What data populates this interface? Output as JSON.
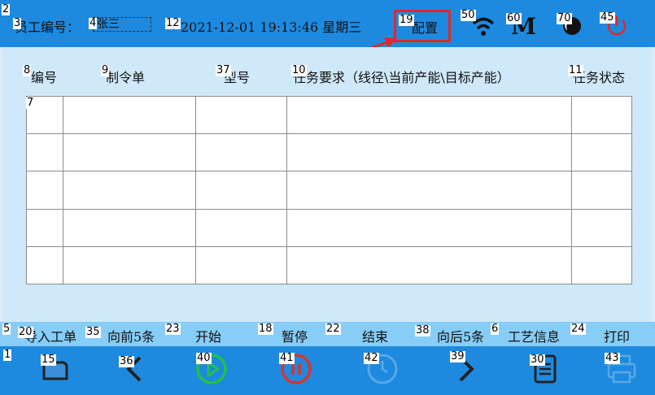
{
  "header": {
    "employee_label": "员工编号：",
    "employee_value": "张三",
    "datetime": "2021-12-01 19:13:46 星期三",
    "config_label": "配置"
  },
  "columns": [
    "编号",
    "制令单",
    "型号",
    "任务要求（线径\\当前产能\\目标产能）",
    "任务状态"
  ],
  "actions": {
    "import": "导入工单",
    "prev5": "向前5条",
    "start": "开始",
    "pause": "暂停",
    "end": "结束",
    "next5": "向后5条",
    "process_info": "工艺信息",
    "print": "打印"
  },
  "status_icons": [
    "wifi-icon",
    "m-logo-icon",
    "moon-icon",
    "power-icon"
  ],
  "tags": {
    "t1": "1",
    "t2": "2",
    "t3": "3",
    "t4": "4",
    "t5": "5",
    "t6": "6",
    "t7": "7",
    "t8": "8",
    "t9": "9",
    "t10": "10",
    "t11": "11",
    "t12": "12",
    "t15": "15",
    "t18": "18",
    "t19": "19",
    "t20": "20",
    "t22": "22",
    "t23": "23",
    "t24": "24",
    "t30": "30",
    "t35": "35",
    "t36": "36",
    "t37": "37",
    "t38": "38",
    "t39": "39",
    "t40": "40",
    "t41": "41",
    "t42": "42",
    "t43": "43",
    "t45": "45",
    "t50": "50",
    "t60": "60",
    "t70": "70"
  },
  "colors": {
    "bar_blue": "#1d8ae0",
    "panel_blue": "#cfe9fb",
    "action_blue": "#86cdf8",
    "highlight_red": "#e02828",
    "play_green": "#22c24a",
    "pause_red": "#d9342b",
    "disabled": "#59a8e6",
    "dark": "#222222"
  }
}
